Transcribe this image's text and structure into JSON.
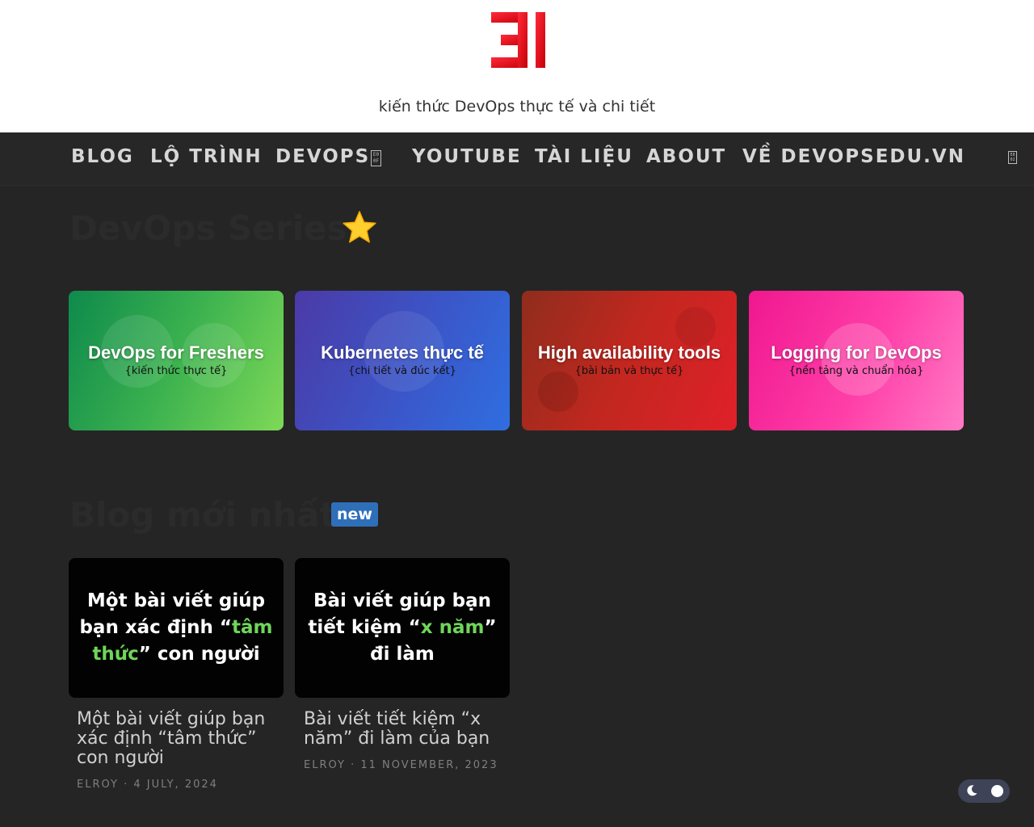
{
  "header": {
    "tagline": "kiến thức DevOps thực tế và chi tiết",
    "logo_colors": [
      "#ff1744",
      "#c20000"
    ]
  },
  "nav": {
    "items": [
      {
        "label": "BLOG"
      },
      {
        "label": "LỘ TRÌNH"
      },
      {
        "label": "DEVOPS",
        "icon": "dropdown-icon"
      },
      {
        "label": "YOUTUBE"
      },
      {
        "label": "TÀI LIỆU"
      },
      {
        "label": "ABOUT"
      },
      {
        "label": "VỀ DEVOPSEDU.VN"
      }
    ],
    "dropdown_glyph": "E0 0F",
    "search_glyph": "E8 02"
  },
  "series": {
    "title": "DevOps Series",
    "icon": "star-icon",
    "cards": [
      {
        "title": "DevOps for Freshers",
        "subtitle": "{kiến thức thực tế}"
      },
      {
        "title": "Kubernetes thực tế",
        "subtitle": "{chi tiết và đúc kết}"
      },
      {
        "title": "High availability tools",
        "subtitle": "{bài bản và thực tế}"
      },
      {
        "title": "Logging for DevOps",
        "subtitle": "{nền tảng và chuẩn hóa}"
      }
    ]
  },
  "blog": {
    "title": "Blog mới nhất",
    "badge": "new",
    "posts": [
      {
        "thumb_pre": "Một bài viết giúp bạn xác định “",
        "thumb_highlight": "tâm thức",
        "thumb_post": "” con người",
        "title": "Một bài viết giúp bạn xác định “tâm thức” con người",
        "meta": "ELROY ·  4 JULY, 2024"
      },
      {
        "thumb_pre": "Bài viết giúp bạn tiết kiệm “",
        "thumb_highlight": "x năm",
        "thumb_post": "” đi làm",
        "title": "Bài viết tiết kiệm “x năm” đi làm của bạn",
        "meta": "ELROY ·  11 NOVEMBER, 2023"
      }
    ]
  },
  "theme_toggle": {
    "icon": "moon-icon",
    "state": "dark"
  }
}
